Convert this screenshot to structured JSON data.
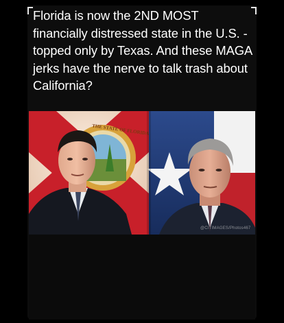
{
  "post": {
    "headline": "Florida is now the 2ND MOST financially distressed state in the U.S. - topped only by Texas. And these MAGA jerks have the nerve to talk trash about California?",
    "seal_text": "THE STATE OF FLORIDA",
    "watermark": "@CITIMAGES/Photos467"
  },
  "colors": {
    "background": "#000000",
    "florida_red": "#c8202a",
    "texas_blue": "#1f3b7a",
    "text": "#ffffff"
  }
}
